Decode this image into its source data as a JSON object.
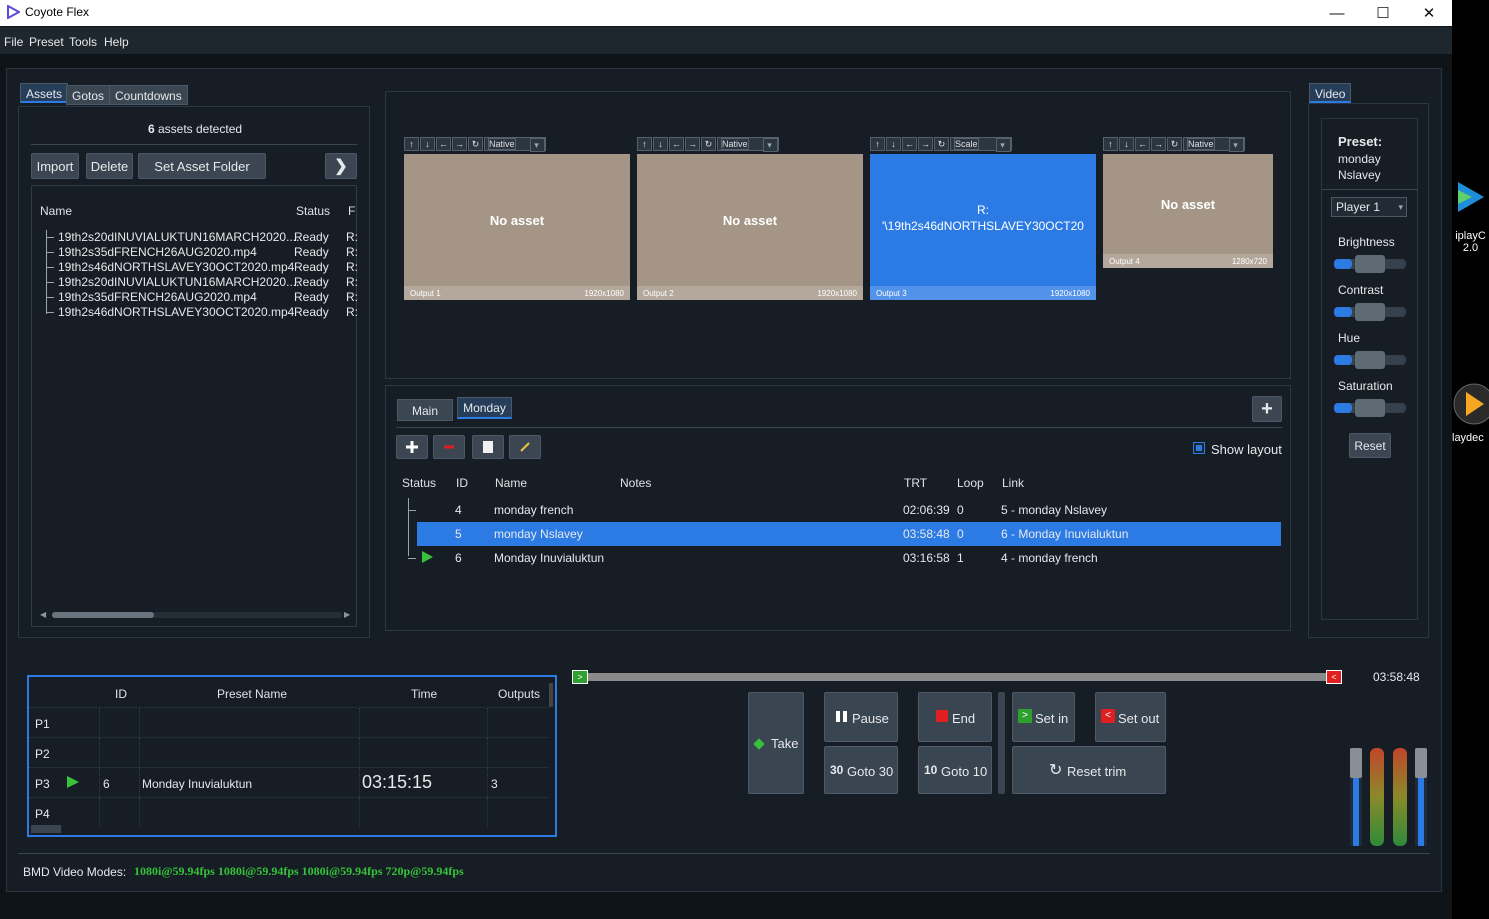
{
  "window": {
    "title": "Coyote Flex",
    "minimize": "—",
    "maximize": "☐",
    "close": "✕"
  },
  "menu": [
    "File",
    "Preset",
    "Tools",
    "Help"
  ],
  "left": {
    "tabs": [
      "Assets",
      "Gotos",
      "Countdowns"
    ],
    "count": "6",
    "count_suffix": "assets detected",
    "buttons": {
      "import": "Import",
      "delete": "Delete",
      "set_folder": "Set Asset Folder",
      "next": "❯"
    },
    "columns": [
      "Name",
      "Status",
      "F"
    ],
    "rows": [
      {
        "name": "19th2s20dINUVIALUKTUN16MARCH2020....",
        "status": "Ready",
        "f": "R:"
      },
      {
        "name": "19th2s35dFRENCH26AUG2020.mp4",
        "status": "Ready",
        "f": "R:"
      },
      {
        "name": "19th2s46dNORTHSLAVEY30OCT2020.mp4",
        "status": "Ready",
        "f": "R:"
      },
      {
        "name": "19th2s20dINUVIALUKTUN16MARCH2020....",
        "status": "Ready",
        "f": "R:"
      },
      {
        "name": "19th2s35dFRENCH26AUG2020.mp4",
        "status": "Ready",
        "f": "R:"
      },
      {
        "name": "19th2s46dNORTHSLAVEY30OCT2020.mp4",
        "status": "Ready",
        "f": "R:"
      }
    ]
  },
  "outputs": [
    {
      "mode": "Native",
      "text": "No asset",
      "label": "Output 1",
      "res": "1920x1080"
    },
    {
      "mode": "Native",
      "text": "No asset",
      "label": "Output 2",
      "res": "1920x1080"
    },
    {
      "mode": "Scale",
      "text": "R:\n'\\19th2s46dNORTHSLAVEY30OCT20",
      "label": "Output 3",
      "res": "1920x1080"
    },
    {
      "mode": "Native",
      "text": "No asset",
      "label": "Output 4",
      "res": "1280x720"
    }
  ],
  "tool_icons": [
    "↑",
    "↓",
    "←",
    "→",
    "↻"
  ],
  "playlist": {
    "tabs": [
      "Main",
      "Monday"
    ],
    "add": "+",
    "show_layout": "Show layout",
    "columns": [
      "Status",
      "ID",
      "Name",
      "Notes",
      "TRT",
      "Loop",
      "Link"
    ],
    "rows": [
      {
        "id": "4",
        "name": "monday french",
        "notes": "",
        "trt": "02:06:39",
        "loop": "0",
        "link": "5 - monday Nslavey"
      },
      {
        "id": "5",
        "name": "monday Nslavey",
        "notes": "",
        "trt": "03:58:48",
        "loop": "0",
        "link": "6 - Monday Inuvialuktun"
      },
      {
        "id": "6",
        "name": "Monday Inuvialuktun",
        "notes": "",
        "trt": "03:16:58",
        "loop": "1",
        "link": "4 - monday french"
      }
    ]
  },
  "video": {
    "tab": "Video",
    "preset_label": "Preset:",
    "preset_name": "monday Nslavey",
    "player": "Player 1",
    "sliders": [
      {
        "label": "Brightness",
        "value": 0.5
      },
      {
        "label": "Contrast",
        "value": 0.5
      },
      {
        "label": "Hue",
        "value": 0.5
      },
      {
        "label": "Saturation",
        "value": 0.5
      }
    ],
    "reset": "Reset"
  },
  "presets": {
    "columns": [
      "ID",
      "Preset Name",
      "Time",
      "Outputs"
    ],
    "rows": [
      {
        "slot": "P1",
        "id": "",
        "name": "",
        "time": "",
        "outputs": ""
      },
      {
        "slot": "P2",
        "id": "",
        "name": "",
        "time": "",
        "outputs": ""
      },
      {
        "slot": "P3",
        "id": "6",
        "name": "Monday Inuvialuktun",
        "time": "03:15:15",
        "outputs": "3"
      },
      {
        "slot": "P4",
        "id": "",
        "name": "",
        "time": "",
        "outputs": ""
      }
    ]
  },
  "transport": {
    "duration": "03:58:48",
    "progress": 0.0,
    "take": "Take",
    "pause": "Pause",
    "end": "End",
    "set_in": "Set in",
    "set_out": "Set out",
    "goto30_num": "30",
    "goto30": "Goto 30",
    "goto10_num": "10",
    "goto10": "Goto 10",
    "reset_trim": "Reset trim"
  },
  "status": {
    "label": "BMD Video Modes:",
    "modes": "1080i@59.94fps 1080i@59.94fps 1080i@59.94fps 720p@59.94fps"
  },
  "desktop": {
    "icon1": "iplayC\n2.0",
    "icon2": "laydec"
  },
  "colors": {
    "accent": "#2c7be5",
    "green": "#36c23a",
    "red": "#e02020"
  }
}
